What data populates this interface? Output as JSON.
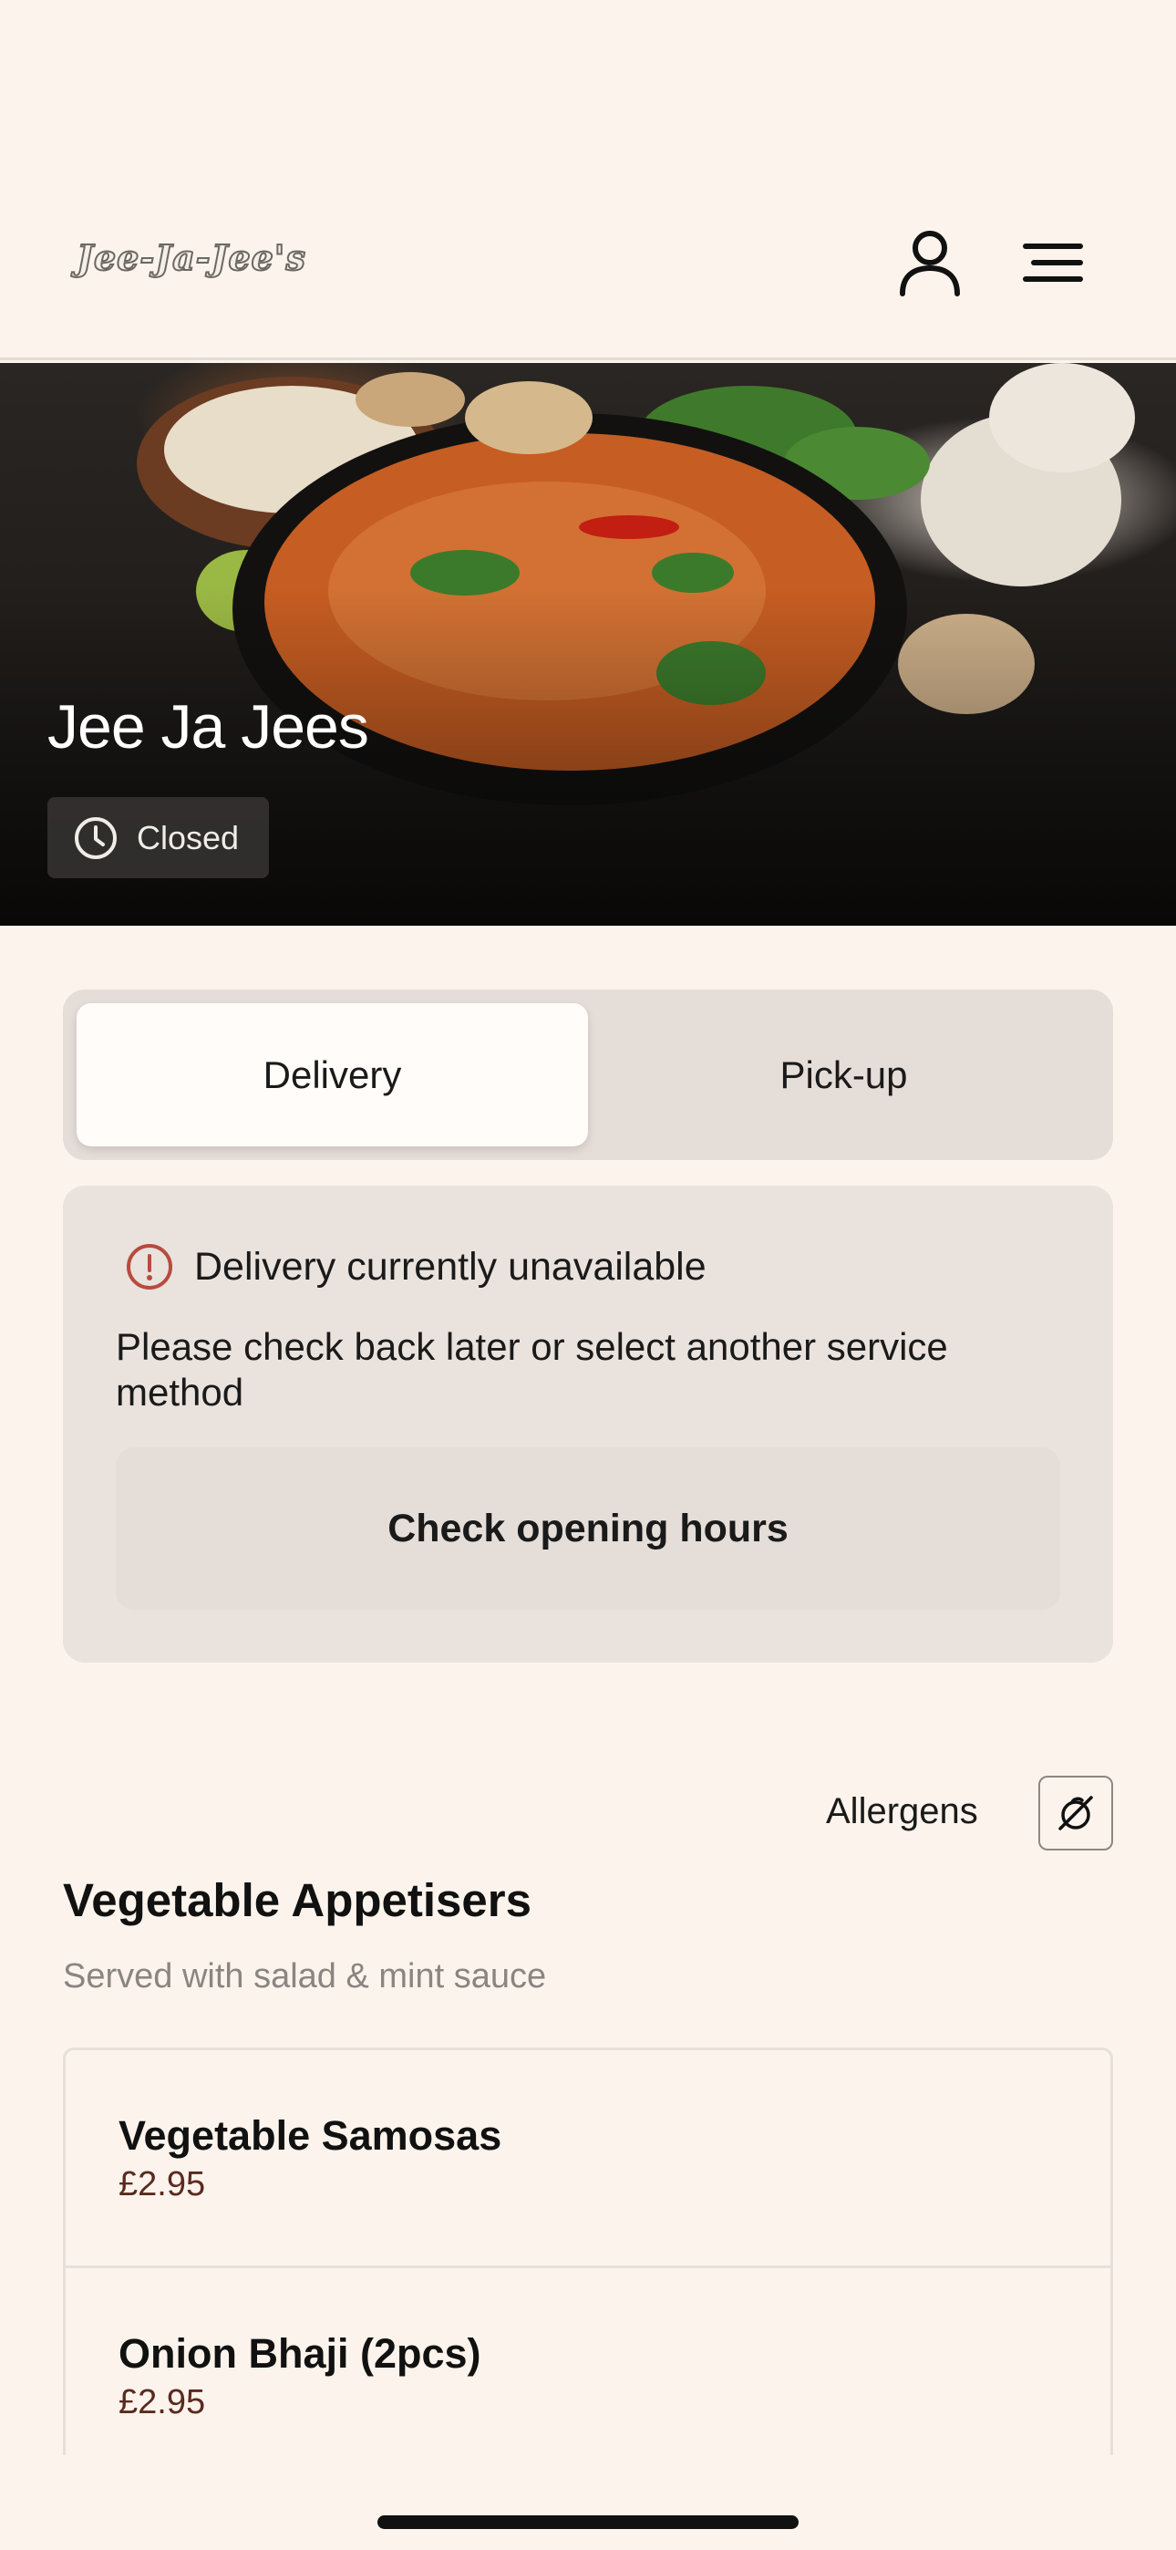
{
  "header": {
    "logo_text": "Jee-Ja-Jee's",
    "account_icon": "user-icon",
    "menu_icon": "menu-icon"
  },
  "hero": {
    "restaurant_name": "Jee Ja Jees",
    "status_icon": "clock-icon",
    "status": "Closed"
  },
  "service": {
    "options": [
      {
        "label": "Delivery",
        "selected": true
      },
      {
        "label": "Pick-up",
        "selected": false
      }
    ]
  },
  "notice": {
    "icon": "info-icon",
    "title": "Delivery currently unavailable",
    "body": "Please check back later or select another service method",
    "button_label": "Check opening hours"
  },
  "allergens": {
    "label": "Allergens",
    "icon": "allergen-filter-icon"
  },
  "menu": {
    "category": {
      "title": "Vegetable Appetisers",
      "subtitle": "Served with salad & mint sauce"
    },
    "items": [
      {
        "name": "Vegetable Samosas",
        "price": "£2.95"
      },
      {
        "name": "Onion Bhaji (2pcs)",
        "price": "£2.95"
      }
    ]
  },
  "colors": {
    "background": "#fcf4ec",
    "price": "#5a2a1f",
    "warning": "#b84a3e"
  }
}
